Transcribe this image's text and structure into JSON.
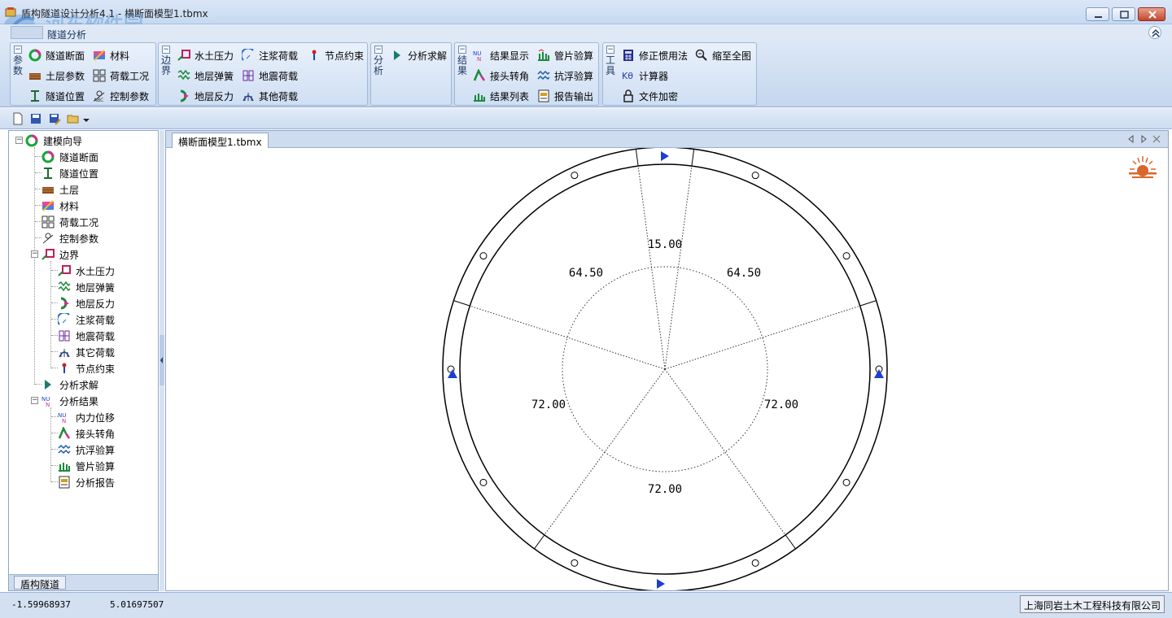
{
  "window": {
    "title": "盾构隧道设计分析4.1 - 横断面模型1.tbmx",
    "watermark": {
      "site": "河东软件园",
      "url": "www.pc0359.cn"
    }
  },
  "ribbon": {
    "tab": "隧道分析",
    "groups": {
      "params": {
        "caption": "参数",
        "items": [
          {
            "label": "隧道断面",
            "icon": "tunnel-section-icon"
          },
          {
            "label": "材料",
            "icon": "material-icon"
          },
          {
            "label": "土层参数",
            "icon": "soil-layer-icon"
          },
          {
            "label": "荷载工况",
            "icon": "load-case-icon"
          },
          {
            "label": "隧道位置",
            "icon": "tunnel-position-icon"
          },
          {
            "label": "控制参数",
            "icon": "control-params-icon"
          }
        ]
      },
      "boundary": {
        "caption": "边界",
        "items": [
          {
            "label": "水土压力",
            "icon": "water-soil-pressure-icon"
          },
          {
            "label": "注浆荷载",
            "icon": "grouting-load-icon"
          },
          {
            "label": "节点约束",
            "icon": "node-constraint-icon"
          },
          {
            "label": "地层弹簧",
            "icon": "ground-spring-icon"
          },
          {
            "label": "地震荷载",
            "icon": "seismic-load-icon"
          },
          {
            "label": "地层反力",
            "icon": "ground-reaction-icon"
          },
          {
            "label": "其他荷载",
            "icon": "other-load-icon"
          }
        ]
      },
      "analysis": {
        "caption": "分析",
        "items": [
          {
            "label": "分析求解",
            "icon": "solve-icon"
          }
        ]
      },
      "results": {
        "caption": "结果",
        "items": [
          {
            "label": "结果显示",
            "icon": "result-display-icon"
          },
          {
            "label": "管片验算",
            "icon": "segment-check-icon"
          },
          {
            "label": "接头转角",
            "icon": "joint-rotation-icon"
          },
          {
            "label": "抗浮验算",
            "icon": "anti-float-icon"
          },
          {
            "label": "结果列表",
            "icon": "result-list-icon"
          },
          {
            "label": "报告输出",
            "icon": "report-output-icon"
          }
        ]
      },
      "tools": {
        "caption": "工具",
        "items": [
          {
            "label": "修正惯用法",
            "icon": "calculator-grid-icon"
          },
          {
            "label": "缩至全图",
            "icon": "zoom-fit-icon"
          },
          {
            "label": "计算器",
            "icon": "k-theta-icon"
          },
          {
            "label": "文件加密",
            "icon": "lock-icon"
          }
        ]
      }
    }
  },
  "tree": {
    "root": "建模向导",
    "items": [
      {
        "label": "隧道断面",
        "icon": "tunnel-section-icon"
      },
      {
        "label": "隧道位置",
        "icon": "tunnel-position-icon"
      },
      {
        "label": "土层",
        "icon": "soil-layer-icon"
      },
      {
        "label": "材料",
        "icon": "material-icon"
      },
      {
        "label": "荷载工况",
        "icon": "load-case-icon"
      },
      {
        "label": "控制参数",
        "icon": "control-params-icon"
      }
    ],
    "boundary": {
      "label": "边界",
      "children": [
        "水土压力",
        "地层弹簧",
        "地层反力",
        "注浆荷载",
        "地震荷载",
        "其它荷载",
        "节点约束"
      ]
    },
    "solve": "分析求解",
    "results": {
      "label": "分析结果",
      "children": [
        "内力位移",
        "接头转角",
        "抗浮验算",
        "管片验算",
        "分析报告"
      ]
    }
  },
  "left_tab": "盾构隧道",
  "document": {
    "tab": "横断面模型1.tbmx",
    "segment_angles": [
      "15.00",
      "64.50",
      "64.50",
      "72.00",
      "72.00",
      "72.00"
    ]
  },
  "status": {
    "x": "-1.59968937",
    "y": "5.01697507",
    "company": "上海同岩土木工程科技有限公司"
  },
  "colors": {
    "ribbon_bg": "#cfdff3",
    "accent": "#1f3a9c",
    "support_marker": "#1d3fd1"
  }
}
